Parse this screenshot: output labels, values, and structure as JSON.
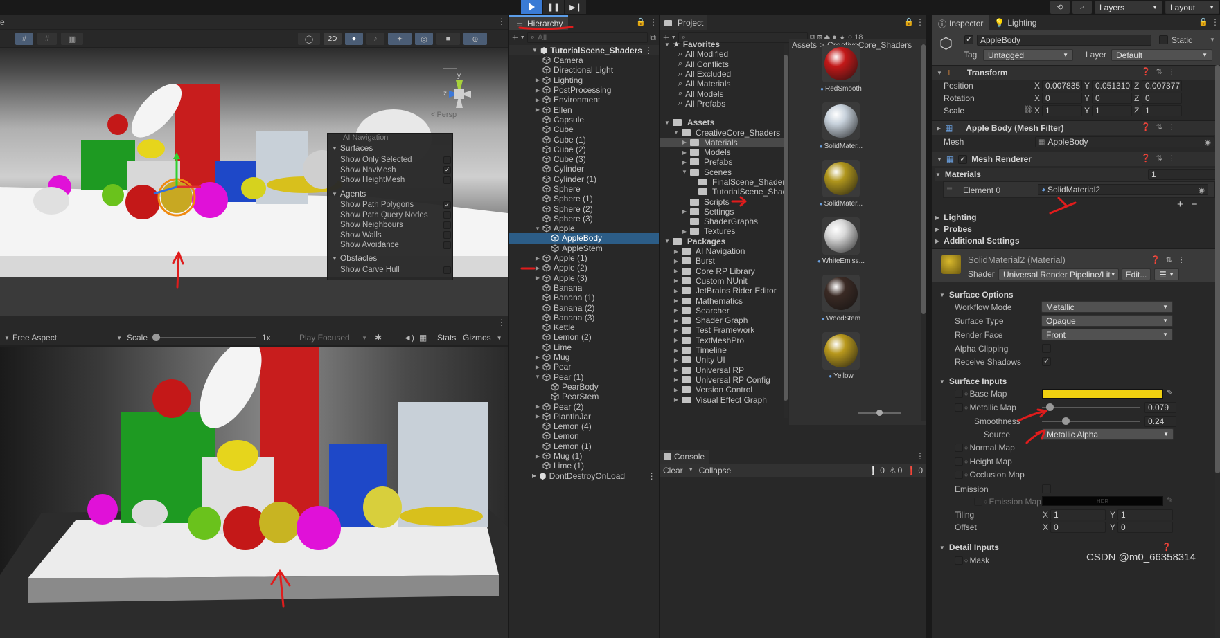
{
  "toolbar": {
    "layers_label": "Layers",
    "layout_label": "Layout"
  },
  "scene": {
    "btn_2d": "2D",
    "persp_label": "Persp",
    "ainav": {
      "title": "AI Navigation",
      "surfaces_header": "Surfaces",
      "surfaces_items": [
        {
          "label": "Show Only Selected",
          "checked": false
        },
        {
          "label": "Show NavMesh",
          "checked": true
        },
        {
          "label": "Show HeightMesh",
          "checked": false
        }
      ],
      "agents_header": "Agents",
      "agents_items": [
        {
          "label": "Show Path Polygons",
          "checked": true
        },
        {
          "label": "Show Path Query Nodes",
          "checked": false
        },
        {
          "label": "Show Neighbours",
          "checked": false
        },
        {
          "label": "Show Walls",
          "checked": false
        },
        {
          "label": "Show Avoidance",
          "checked": false
        }
      ],
      "obstacles_header": "Obstacles",
      "obstacles_items": [
        {
          "label": "Show Carve Hull",
          "checked": false
        }
      ]
    }
  },
  "game": {
    "aspect": "Free Aspect",
    "scale_label": "Scale",
    "scale_value": "1x",
    "play_focused": "Play Focused",
    "stats": "Stats",
    "gizmos": "Gizmos"
  },
  "hierarchy": {
    "tab": "Hierarchy",
    "search_placeholder": "All",
    "scene_name": "TutorialScene_Shaders",
    "items": [
      {
        "label": "Camera",
        "depth": 1,
        "arrow": false
      },
      {
        "label": "Directional Light",
        "depth": 1,
        "arrow": false
      },
      {
        "label": "Lighting",
        "depth": 1,
        "arrow": true
      },
      {
        "label": "PostProcessing",
        "depth": 1,
        "arrow": true
      },
      {
        "label": "Environment",
        "depth": 1,
        "arrow": true
      },
      {
        "label": "Ellen",
        "depth": 1,
        "arrow": true
      },
      {
        "label": "Capsule",
        "depth": 1,
        "arrow": false
      },
      {
        "label": "Cube",
        "depth": 1,
        "arrow": false
      },
      {
        "label": "Cube (1)",
        "depth": 1,
        "arrow": false
      },
      {
        "label": "Cube (2)",
        "depth": 1,
        "arrow": false
      },
      {
        "label": "Cube (3)",
        "depth": 1,
        "arrow": false
      },
      {
        "label": "Cylinder",
        "depth": 1,
        "arrow": false
      },
      {
        "label": "Cylinder (1)",
        "depth": 1,
        "arrow": false
      },
      {
        "label": "Sphere",
        "depth": 1,
        "arrow": false
      },
      {
        "label": "Sphere (1)",
        "depth": 1,
        "arrow": false
      },
      {
        "label": "Sphere (2)",
        "depth": 1,
        "arrow": false
      },
      {
        "label": "Sphere (3)",
        "depth": 1,
        "arrow": false
      },
      {
        "label": "Apple",
        "depth": 1,
        "arrow": "open"
      },
      {
        "label": "AppleBody",
        "depth": 2,
        "arrow": false,
        "selected": true
      },
      {
        "label": "AppleStem",
        "depth": 2,
        "arrow": false
      },
      {
        "label": "Apple (1)",
        "depth": 1,
        "arrow": true
      },
      {
        "label": "Apple (2)",
        "depth": 1,
        "arrow": true
      },
      {
        "label": "Apple (3)",
        "depth": 1,
        "arrow": true
      },
      {
        "label": "Banana",
        "depth": 1,
        "arrow": false
      },
      {
        "label": "Banana (1)",
        "depth": 1,
        "arrow": false
      },
      {
        "label": "Banana (2)",
        "depth": 1,
        "arrow": false
      },
      {
        "label": "Banana (3)",
        "depth": 1,
        "arrow": false
      },
      {
        "label": "Kettle",
        "depth": 1,
        "arrow": false
      },
      {
        "label": "Lemon (2)",
        "depth": 1,
        "arrow": false
      },
      {
        "label": "Lime",
        "depth": 1,
        "arrow": false
      },
      {
        "label": "Mug",
        "depth": 1,
        "arrow": true
      },
      {
        "label": "Pear",
        "depth": 1,
        "arrow": true
      },
      {
        "label": "Pear (1)",
        "depth": 1,
        "arrow": "open"
      },
      {
        "label": "PearBody",
        "depth": 2,
        "arrow": false
      },
      {
        "label": "PearStem",
        "depth": 2,
        "arrow": false
      },
      {
        "label": "Pear (2)",
        "depth": 1,
        "arrow": true
      },
      {
        "label": "PlantInJar",
        "depth": 1,
        "arrow": true
      },
      {
        "label": "Lemon (4)",
        "depth": 1,
        "arrow": false
      },
      {
        "label": "Lemon",
        "depth": 1,
        "arrow": false
      },
      {
        "label": "Lemon (1)",
        "depth": 1,
        "arrow": false
      },
      {
        "label": "Mug (1)",
        "depth": 1,
        "arrow": true
      },
      {
        "label": "Lime (1)",
        "depth": 1,
        "arrow": false
      }
    ],
    "dontdestroy": "DontDestroyOnLoad"
  },
  "project": {
    "tab": "Project",
    "hidden_count": "18",
    "favorites_header": "Favorites",
    "favorites": [
      "All Modified",
      "All Conflicts",
      "All Excluded",
      "All Materials",
      "All Models",
      "All Prefabs"
    ],
    "assets_header": "Assets",
    "assets_tree": [
      {
        "label": "CreativeCore_Shaders",
        "depth": 1,
        "arrow": "open"
      },
      {
        "label": "Materials",
        "depth": 2,
        "arrow": true,
        "selected": true
      },
      {
        "label": "Models",
        "depth": 2,
        "arrow": true
      },
      {
        "label": "Prefabs",
        "depth": 2,
        "arrow": true
      },
      {
        "label": "Scenes",
        "depth": 2,
        "arrow": "open"
      },
      {
        "label": "FinalScene_Shaders",
        "depth": 3,
        "arrow": false
      },
      {
        "label": "TutorialScene_Shaders",
        "depth": 3,
        "arrow": false
      },
      {
        "label": "Scripts",
        "depth": 2,
        "arrow": false
      },
      {
        "label": "Settings",
        "depth": 2,
        "arrow": true
      },
      {
        "label": "ShaderGraphs",
        "depth": 2,
        "arrow": false
      },
      {
        "label": "Textures",
        "depth": 2,
        "arrow": true
      }
    ],
    "packages_header": "Packages",
    "packages": [
      "AI Navigation",
      "Burst",
      "Core RP Library",
      "Custom NUnit",
      "JetBrains Rider Editor",
      "Mathematics",
      "Searcher",
      "Shader Graph",
      "Test Framework",
      "TextMeshPro",
      "Timeline",
      "Unity UI",
      "Universal RP",
      "Universal RP Config",
      "Version Control",
      "Visual Effect Graph"
    ],
    "breadcrumb": [
      "Assets",
      "CreativeCore_Shaders"
    ],
    "materials": [
      {
        "label": "RedSmooth",
        "color": "#c31818"
      },
      {
        "label": "SolidMater...",
        "color": "#c8d2dc"
      },
      {
        "label": "SolidMater...",
        "color": "#b0961c"
      },
      {
        "label": "WhiteEmiss...",
        "color": "#d8d8d8"
      },
      {
        "label": "WoodStem",
        "color": "#3a2a24"
      },
      {
        "label": "Yellow",
        "color": "#b8981c"
      }
    ]
  },
  "console": {
    "tab": "Console",
    "clear": "Clear",
    "collapse": "Collapse",
    "count_log": "0",
    "count_warn": "0",
    "count_err": "0"
  },
  "inspector": {
    "tab": "Inspector",
    "lighting_tab": "Lighting",
    "object_name": "AppleBody",
    "static_label": "Static",
    "tag_label": "Tag",
    "tag_value": "Untagged",
    "layer_label": "Layer",
    "layer_value": "Default",
    "transform": {
      "title": "Transform",
      "position_label": "Position",
      "position": [
        "0.007835",
        "0.051310",
        "0.007377"
      ],
      "rotation_label": "Rotation",
      "rotation": [
        "0",
        "0",
        "0"
      ],
      "scale_label": "Scale",
      "scale": [
        "1",
        "1",
        "1"
      ]
    },
    "meshfilter": {
      "title": "Apple Body (Mesh Filter)",
      "mesh_label": "Mesh",
      "mesh_value": "AppleBody"
    },
    "meshrenderer": {
      "title": "Mesh Renderer",
      "materials_label": "Materials",
      "materials_count": "1",
      "element_label": "Element 0",
      "element_value": "SolidMaterial2",
      "lighting": "Lighting",
      "probes": "Probes",
      "additional": "Additional Settings"
    },
    "material": {
      "title": "SolidMaterial2 (Material)",
      "shader_label": "Shader",
      "shader_value": "Universal Render Pipeline/Lit",
      "edit_label": "Edit...",
      "surface_options": "Surface Options",
      "workflow_label": "Workflow Mode",
      "workflow_value": "Metallic",
      "surface_type_label": "Surface Type",
      "surface_type_value": "Opaque",
      "render_face_label": "Render Face",
      "render_face_value": "Front",
      "alpha_clip_label": "Alpha Clipping",
      "receive_shadows_label": "Receive Shadows",
      "surface_inputs": "Surface Inputs",
      "base_map_label": "Base Map",
      "base_color": "#f0d010",
      "metallic_label": "Metallic Map",
      "metallic_value": "0.079",
      "smoothness_label": "Smoothness",
      "smoothness_value": "0.24",
      "source_label": "Source",
      "source_value": "Metallic Alpha",
      "normal_label": "Normal Map",
      "height_label": "Height Map",
      "occlusion_label": "Occlusion Map",
      "emission_label": "Emission",
      "emission_map_label": "Emission Map",
      "hdr_label": "HDR",
      "tiling_label": "Tiling",
      "tiling": [
        "1",
        "1"
      ],
      "offset_label": "Offset",
      "offset": [
        "0",
        "0"
      ],
      "detail_inputs": "Detail Inputs",
      "mask_label": "Mask"
    }
  },
  "watermark": "CSDN @m0_66358314"
}
